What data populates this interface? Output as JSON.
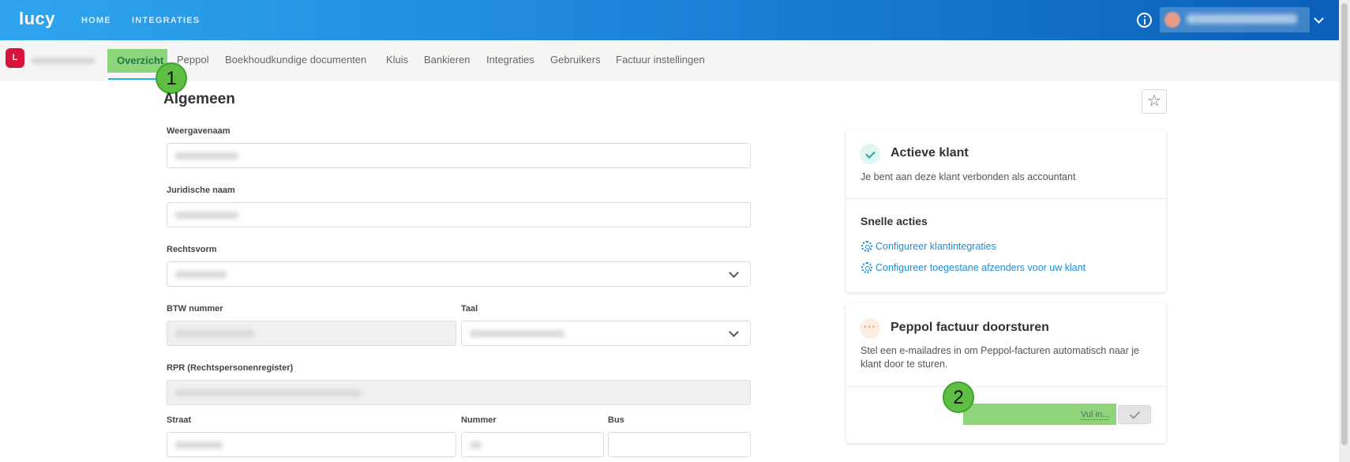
{
  "topbar": {
    "logo": "lucy",
    "nav": [
      {
        "label": "HOME"
      },
      {
        "label": "INTEGRATIES"
      }
    ]
  },
  "client": {
    "badge": "L"
  },
  "tabs": [
    {
      "label": "Overzicht",
      "active": true
    },
    {
      "label": "Peppol"
    },
    {
      "label": "Boekhoudkundige documenten"
    },
    {
      "label": "Kluis"
    },
    {
      "label": "Bankieren"
    },
    {
      "label": "Integraties"
    },
    {
      "label": "Gebruikers"
    },
    {
      "label": "Factuur instellingen"
    }
  ],
  "markers": [
    "1",
    "2"
  ],
  "form": {
    "title": "Algemeen",
    "star": "☆",
    "labels": {
      "display_name": "Weergavenaam",
      "legal_name": "Juridische naam",
      "legal_form": "Rechtsvorm",
      "vat": "BTW nummer",
      "language": "Taal",
      "rpr": "RPR (Rechtspersonenregister)",
      "street": "Straat",
      "number": "Nummer",
      "bus": "Bus"
    }
  },
  "status_card": {
    "title": "Actieve klant",
    "text": "Je bent aan deze klant verbonden als accountant",
    "quick_actions_title": "Snelle acties",
    "actions": [
      {
        "label": "Configureer klantintegraties"
      },
      {
        "label": "Configureer toegestane afzenders voor uw klant"
      }
    ]
  },
  "peppol_card": {
    "icon": "···",
    "title": "Peppol factuur doorsturen",
    "text": "Stel een e-mailadres in om Peppol-facturen automatisch naar je klant door te sturen.",
    "input_placeholder": "Vul in..."
  },
  "colors": {
    "topbar_start": "#2fa5ee",
    "topbar_end": "#0b5fb8",
    "highlight_green": "#8ed47a",
    "link_blue": "#1f8dd6",
    "badge_red": "#d7143c"
  }
}
